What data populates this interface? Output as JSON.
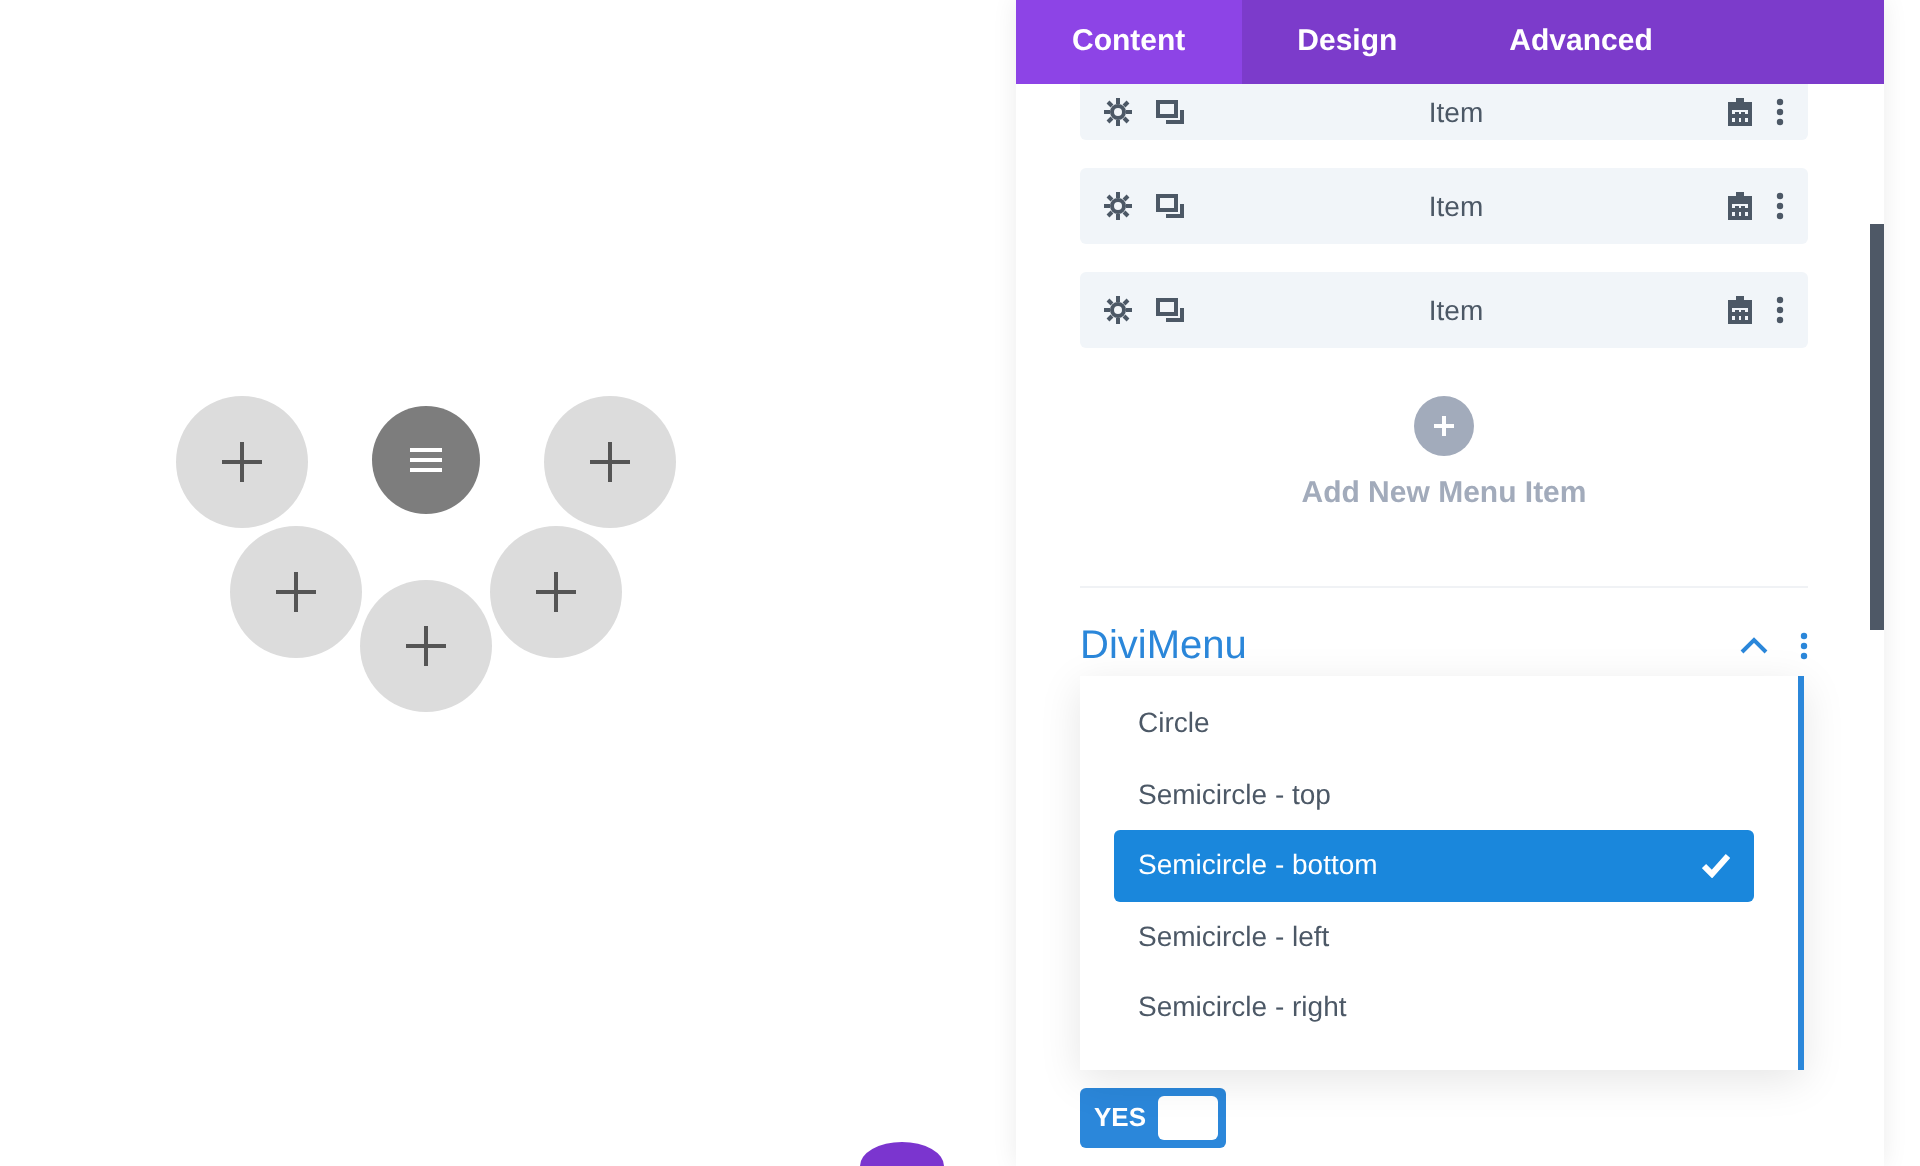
{
  "canvas": {
    "buttons": [
      {
        "kind": "plus"
      },
      {
        "kind": "menu"
      },
      {
        "kind": "plus"
      },
      {
        "kind": "plus"
      },
      {
        "kind": "plus"
      },
      {
        "kind": "plus"
      }
    ]
  },
  "tabs": [
    {
      "label": "Content",
      "selected": true
    },
    {
      "label": "Design",
      "selected": false
    },
    {
      "label": "Advanced",
      "selected": false
    }
  ],
  "menu_items": [
    {
      "label": "Item"
    },
    {
      "label": "Item"
    },
    {
      "label": "Item"
    }
  ],
  "add_item": {
    "label": "Add New Menu Item"
  },
  "section": {
    "title": "DiviMenu",
    "expanded": true
  },
  "dropdown": {
    "options": [
      {
        "label": "Circle",
        "selected": false
      },
      {
        "label": "Semicircle - top",
        "selected": false
      },
      {
        "label": "Semicircle - bottom",
        "selected": true
      },
      {
        "label": "Semicircle - left",
        "selected": false
      },
      {
        "label": "Semicircle - right",
        "selected": false
      }
    ]
  },
  "toggle": {
    "label": "YES",
    "on": true
  }
}
